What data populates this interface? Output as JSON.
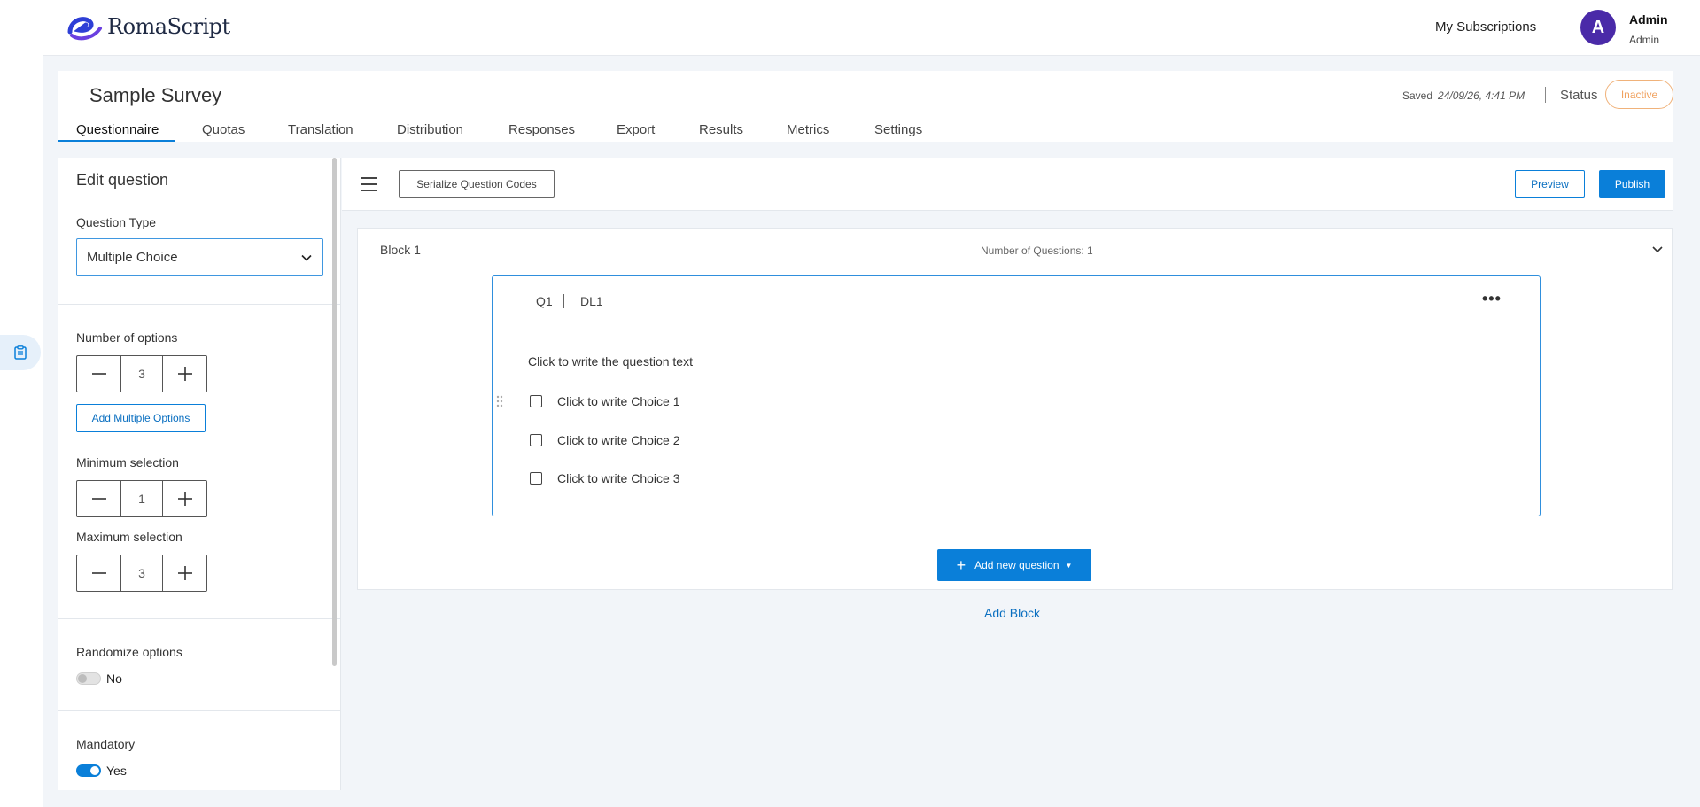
{
  "app": {
    "logo_text": "RomaScript",
    "my_subscriptions": "My Subscriptions",
    "user": {
      "avatar_letter": "A",
      "name": "Admin",
      "role": "Admin"
    }
  },
  "survey": {
    "title": "Sample Survey",
    "saved_label": "Saved",
    "saved_time": "24/09/26, 4:41 PM",
    "status_label": "Status",
    "status_value": "Inactive",
    "tabs": [
      {
        "label": "Questionnaire",
        "active": true
      },
      {
        "label": "Quotas"
      },
      {
        "label": "Translation"
      },
      {
        "label": "Distribution"
      },
      {
        "label": "Responses"
      },
      {
        "label": "Export"
      },
      {
        "label": "Results"
      },
      {
        "label": "Metrics"
      },
      {
        "label": "Settings"
      }
    ]
  },
  "edit_panel": {
    "title": "Edit question",
    "question_type_label": "Question Type",
    "question_type_value": "Multiple Choice",
    "num_options_label": "Number of options",
    "num_options_value": "3",
    "add_multiple_options": "Add Multiple Options",
    "min_selection_label": "Minimum selection",
    "min_selection_value": "1",
    "max_selection_label": "Maximum selection",
    "max_selection_value": "3",
    "randomize_label": "Randomize options",
    "randomize_value": "No",
    "mandatory_label": "Mandatory",
    "mandatory_value": "Yes"
  },
  "toolbar": {
    "serialize": "Serialize Question Codes",
    "preview": "Preview",
    "publish": "Publish"
  },
  "block": {
    "title": "Block 1",
    "count_text": "Number of Questions: 1",
    "question": {
      "id": "Q1",
      "code": "DL1",
      "more": "•••",
      "text": "Click to write the question text",
      "choices": [
        "Click to write Choice 1",
        "Click to write Choice 2",
        "Click to write Choice 3"
      ]
    },
    "add_new_question": "Add new question"
  },
  "add_block": "Add Block",
  "colors": {
    "accent": "#0a7fd9",
    "avatar": "#4a2aa8",
    "inactive": "#f0a260"
  }
}
